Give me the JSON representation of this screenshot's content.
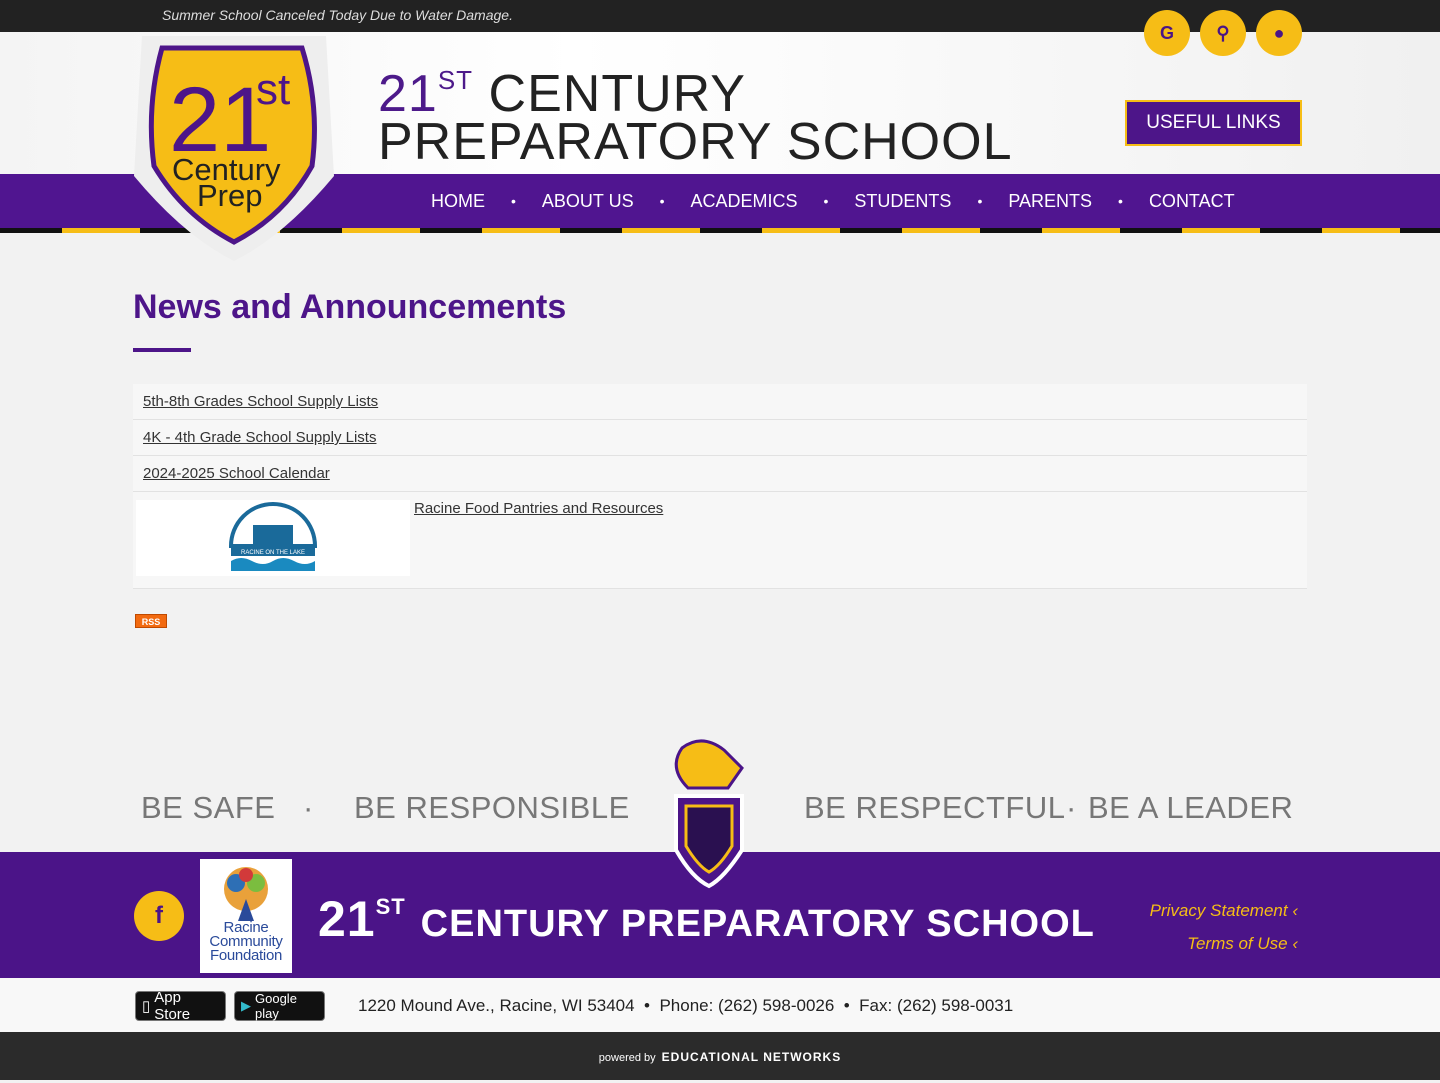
{
  "alert": "Summer School Canceled Today Due to Water Damage.",
  "header": {
    "icons": [
      "translate-icon",
      "search-icon",
      "lock-icon"
    ],
    "title_num": "21",
    "title_sup": "ST",
    "title_line1": "Century",
    "title_line2": "Preparatory School",
    "useful_links": "USEFUL LINKS",
    "logo_text": "21st Century Prep"
  },
  "nav": [
    "HOME",
    "ABOUT US",
    "ACADEMICS",
    "STUDENTS",
    "PARENTS",
    "CONTACT"
  ],
  "main": {
    "heading": "News and Announcements",
    "items": [
      "5th-8th Grades School Supply Lists",
      "4K - 4th Grade School Supply Lists",
      "2024-2025 School Calendar",
      "Racine Food Pantries and Resources"
    ],
    "image_caption": "RACINE ON THE LAKE",
    "rss": "RSS"
  },
  "motto": [
    "BE SAFE",
    "BE RESPONSIBLE",
    "BE RESPECTFUL",
    "BE A LEADER"
  ],
  "footer": {
    "facebook": "f",
    "partner": "Racine Community Foundation",
    "title_num": "21",
    "title_sup": "ST",
    "title": "Century Preparatory School",
    "links": [
      "Privacy Statement",
      "Terms of Use"
    ],
    "app_store": "App Store",
    "google_play": "Google play",
    "address": "1220 Mound Ave., Racine, WI 53404",
    "phone": "Phone: (262) 598-0026",
    "fax": "Fax: (262) 598-0031",
    "powered_by": "powered by",
    "provider": "EDUCATIONAL NETWORKS"
  },
  "colors": {
    "purple": "#4d1589",
    "gold": "#f6bd16"
  }
}
